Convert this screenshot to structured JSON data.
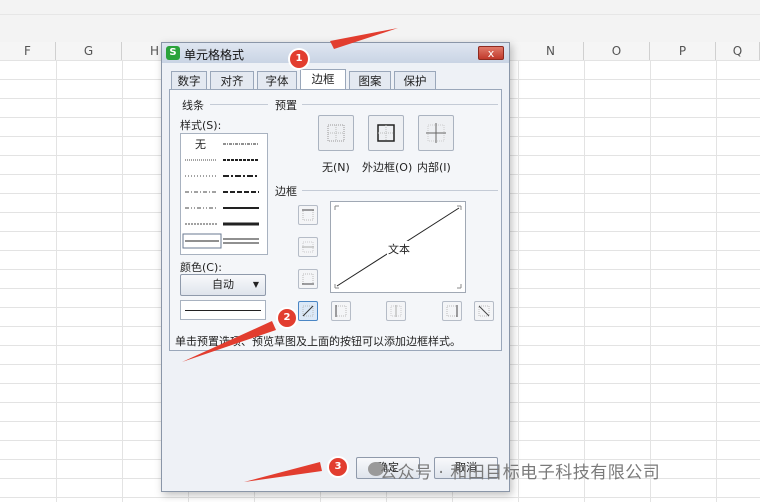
{
  "spreadsheet": {
    "columns": [
      {
        "label": "F"
      },
      {
        "label": "G"
      },
      {
        "label": "H"
      },
      {
        "label": "N"
      },
      {
        "label": "O"
      },
      {
        "label": "P"
      },
      {
        "label": "Q"
      }
    ]
  },
  "dialog": {
    "app_logo": "S",
    "title": "单元格格式",
    "close_label": "x",
    "tabs": [
      {
        "label": "数字"
      },
      {
        "label": "对齐"
      },
      {
        "label": "字体"
      },
      {
        "label": "边框",
        "active": true
      },
      {
        "label": "图案"
      },
      {
        "label": "保护"
      }
    ],
    "line_group_label": "线条",
    "style_label": "样式(S):",
    "style_none": "无",
    "color_label": "颜色(C):",
    "color_value": "自动",
    "preset_group_label": "预置",
    "presets": [
      {
        "label": "无(N)"
      },
      {
        "label": "外边框(O)"
      },
      {
        "label": "内部(I)"
      }
    ],
    "border_group_label": "边框",
    "preview_text": "文本",
    "hint": "单击预置选项、预览草图及上面的按钮可以添加边框样式。",
    "ok_label": "确定",
    "cancel_label": "取消"
  },
  "annotations": [
    {
      "number": "1"
    },
    {
      "number": "2"
    },
    {
      "number": "3"
    }
  ],
  "watermark": "公众号 · 和田目标电子科技有限公司",
  "colors": {
    "marker": "#e23d2f",
    "app_logo": "#2aa33b",
    "close_button": "#c0392b"
  }
}
